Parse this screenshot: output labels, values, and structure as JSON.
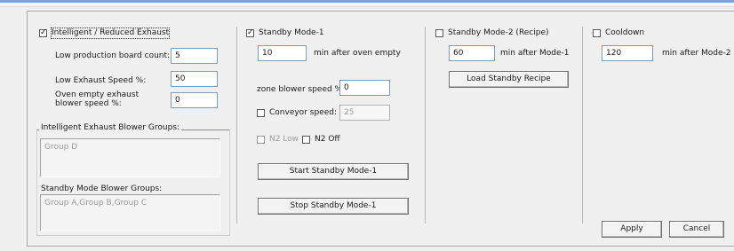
{
  "exhaust": {
    "checkbox_label": "Intelligent / Reduced Exhaust",
    "checked": true,
    "low_board_label": "Low production board count:",
    "low_board_value": "5",
    "low_speed_label": "Low Exhaust Speed %:",
    "low_speed_value": "50",
    "oven_empty_label_1": "Oven empty exhaust",
    "oven_empty_label_2": "blower speed %:",
    "oven_empty_value": "0",
    "intelligent_groups_label": "Intelligent Exhaust Blower Groups:",
    "intelligent_groups_value": "Group D",
    "standby_groups_label": "Standby Mode Blower Groups:",
    "standby_groups_value": "Group A,Group B,Group C"
  },
  "standby1": {
    "checkbox_label": "Standby Mode-1",
    "checked": true,
    "minutes_value": "10",
    "minutes_suffix": "min after oven empty",
    "zone_speed_label": "zone blower speed %:",
    "zone_speed_value": "0",
    "conveyor_label": "Conveyor speed:",
    "conveyor_value": "25",
    "n2_low_label": "N2 Low",
    "n2_off_label": "N2 Off",
    "start_button": "Start Standby Mode-1",
    "stop_button": "Stop Standby Mode-1"
  },
  "standby2": {
    "checkbox_label": "Standby Mode-2 (Recipe)",
    "checked": false,
    "minutes_value": "60",
    "minutes_suffix": "min after Mode-1",
    "load_button": "Load Standby Recipe"
  },
  "cooldown": {
    "checkbox_label": "Cooldown",
    "checked": false,
    "minutes_value": "120",
    "minutes_suffix": "min after Mode-2"
  },
  "actions": {
    "apply": "Apply",
    "cancel": "Cancel"
  },
  "colors": {
    "window_bg": "#f0f0f0",
    "disabled_text": "#9a9a9a",
    "title_accent": "#7aa7d6"
  }
}
